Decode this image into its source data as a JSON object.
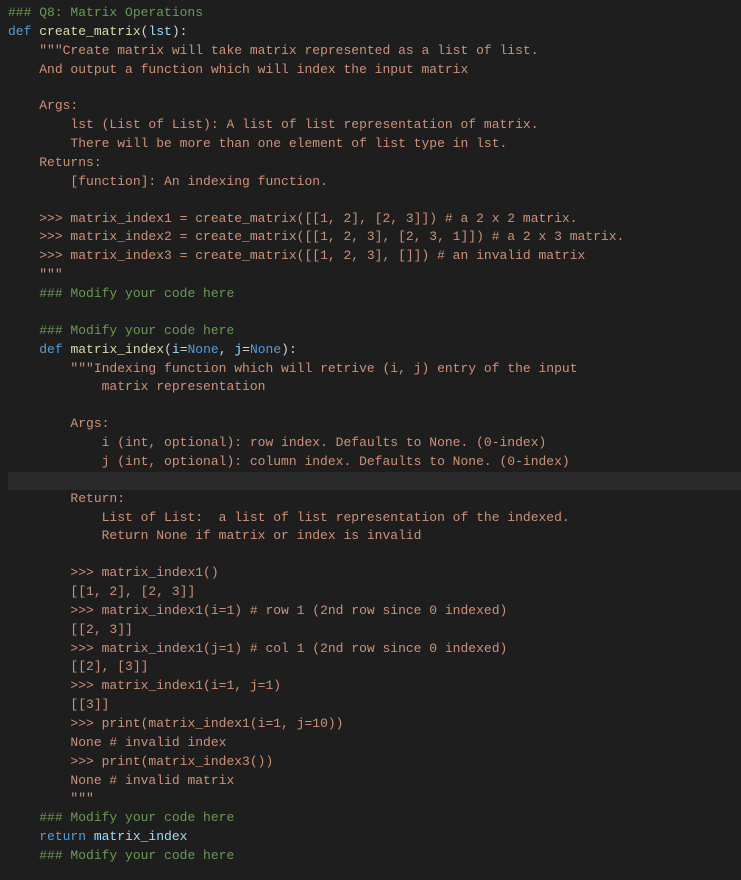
{
  "code": {
    "lines": [
      {
        "indent": 0,
        "tokens": [
          [
            "c-comment",
            "### Q8: Matrix Operations"
          ]
        ]
      },
      {
        "indent": 0,
        "tokens": [
          [
            "c-keyword",
            "def "
          ],
          [
            "c-funcdef",
            "create_matrix"
          ],
          [
            "c-default",
            "("
          ],
          [
            "c-param",
            "lst"
          ],
          [
            "c-default",
            "):"
          ]
        ]
      },
      {
        "indent": 1,
        "tokens": [
          [
            "c-string",
            "\"\"\"Create matrix will take matrix represented as a list of list."
          ]
        ]
      },
      {
        "indent": 1,
        "tokens": [
          [
            "c-string",
            "And output a function which will index the input matrix"
          ]
        ]
      },
      {
        "indent": 0,
        "tokens": []
      },
      {
        "indent": 1,
        "tokens": [
          [
            "c-string",
            "Args:"
          ]
        ]
      },
      {
        "indent": 2,
        "tokens": [
          [
            "c-string",
            "lst (List of List): A list of list representation of matrix."
          ]
        ]
      },
      {
        "indent": 2,
        "tokens": [
          [
            "c-string",
            "There will be more than one element of list type in lst."
          ]
        ]
      },
      {
        "indent": 1,
        "tokens": [
          [
            "c-string",
            "Returns:"
          ]
        ]
      },
      {
        "indent": 2,
        "tokens": [
          [
            "c-string",
            "[function]: An indexing function."
          ]
        ]
      },
      {
        "indent": 0,
        "tokens": []
      },
      {
        "indent": 1,
        "tokens": [
          [
            "c-string",
            ">>> matrix_index1 = create_matrix([[1, 2], [2, 3]]) # a 2 x 2 matrix."
          ]
        ]
      },
      {
        "indent": 1,
        "tokens": [
          [
            "c-string",
            ">>> matrix_index2 = create_matrix([[1, 2, 3], [2, 3, 1]]) # a 2 x 3 matrix."
          ]
        ]
      },
      {
        "indent": 1,
        "tokens": [
          [
            "c-string",
            ">>> matrix_index3 = create_matrix([[1, 2, 3], []]) # an invalid matrix"
          ]
        ]
      },
      {
        "indent": 1,
        "tokens": [
          [
            "c-string",
            "\"\"\""
          ]
        ]
      },
      {
        "indent": 1,
        "tokens": [
          [
            "c-comment",
            "### Modify your code here"
          ]
        ]
      },
      {
        "indent": 0,
        "tokens": []
      },
      {
        "indent": 1,
        "tokens": [
          [
            "c-comment",
            "### Modify your code here"
          ]
        ]
      },
      {
        "indent": 1,
        "tokens": [
          [
            "c-keyword",
            "def "
          ],
          [
            "c-funcdef",
            "matrix_index"
          ],
          [
            "c-default",
            "("
          ],
          [
            "c-param",
            "i"
          ],
          [
            "c-op",
            "="
          ],
          [
            "c-const",
            "None"
          ],
          [
            "c-default",
            ", "
          ],
          [
            "c-param",
            "j"
          ],
          [
            "c-op",
            "="
          ],
          [
            "c-const",
            "None"
          ],
          [
            "c-default",
            "):"
          ]
        ]
      },
      {
        "indent": 2,
        "tokens": [
          [
            "c-string",
            "\"\"\"Indexing function which will retrive (i, j) entry of the input"
          ]
        ]
      },
      {
        "indent": 3,
        "tokens": [
          [
            "c-string",
            "matrix representation"
          ]
        ]
      },
      {
        "indent": 0,
        "tokens": []
      },
      {
        "indent": 2,
        "tokens": [
          [
            "c-string",
            "Args:"
          ]
        ]
      },
      {
        "indent": 3,
        "tokens": [
          [
            "c-string",
            "i (int, optional): row index. Defaults to None. (0-index)"
          ]
        ]
      },
      {
        "indent": 3,
        "tokens": [
          [
            "c-string",
            "j (int, optional): column index. Defaults to None. (0-index)"
          ]
        ]
      },
      {
        "indent": 0,
        "cursor": true,
        "tokens": []
      },
      {
        "indent": 2,
        "tokens": [
          [
            "c-string",
            "Return:"
          ]
        ]
      },
      {
        "indent": 3,
        "tokens": [
          [
            "c-string",
            "List of List:  a list of list representation of the indexed."
          ]
        ]
      },
      {
        "indent": 3,
        "tokens": [
          [
            "c-string",
            "Return None if matrix or index is invalid"
          ]
        ]
      },
      {
        "indent": 0,
        "tokens": []
      },
      {
        "indent": 2,
        "tokens": [
          [
            "c-string",
            ">>> matrix_index1()"
          ]
        ]
      },
      {
        "indent": 2,
        "tokens": [
          [
            "c-string",
            "[[1, 2], [2, 3]]"
          ]
        ]
      },
      {
        "indent": 2,
        "tokens": [
          [
            "c-string",
            ">>> matrix_index1(i=1) # row 1 (2nd row since 0 indexed)"
          ]
        ]
      },
      {
        "indent": 2,
        "tokens": [
          [
            "c-string",
            "[[2, 3]]"
          ]
        ]
      },
      {
        "indent": 2,
        "tokens": [
          [
            "c-string",
            ">>> matrix_index1(j=1) # col 1 (2nd row since 0 indexed)"
          ]
        ]
      },
      {
        "indent": 2,
        "tokens": [
          [
            "c-string",
            "[[2], [3]]"
          ]
        ]
      },
      {
        "indent": 2,
        "tokens": [
          [
            "c-string",
            ">>> matrix_index1(i=1, j=1)"
          ]
        ]
      },
      {
        "indent": 2,
        "tokens": [
          [
            "c-string",
            "[[3]]"
          ]
        ]
      },
      {
        "indent": 2,
        "tokens": [
          [
            "c-string",
            ">>> print(matrix_index1(i=1, j=10))"
          ]
        ]
      },
      {
        "indent": 2,
        "tokens": [
          [
            "c-string",
            "None # invalid index"
          ]
        ]
      },
      {
        "indent": 2,
        "tokens": [
          [
            "c-string",
            ">>> print(matrix_index3())"
          ]
        ]
      },
      {
        "indent": 2,
        "tokens": [
          [
            "c-string",
            "None # invalid matrix"
          ]
        ]
      },
      {
        "indent": 2,
        "tokens": [
          [
            "c-string",
            "\"\"\""
          ]
        ]
      },
      {
        "indent": 1,
        "tokens": [
          [
            "c-comment",
            "### Modify your code here"
          ]
        ]
      },
      {
        "indent": 1,
        "tokens": [
          [
            "c-keyword",
            "return "
          ],
          [
            "c-param",
            "matrix_index"
          ]
        ]
      },
      {
        "indent": 1,
        "tokens": [
          [
            "c-comment",
            "### Modify your code here"
          ]
        ]
      }
    ]
  }
}
